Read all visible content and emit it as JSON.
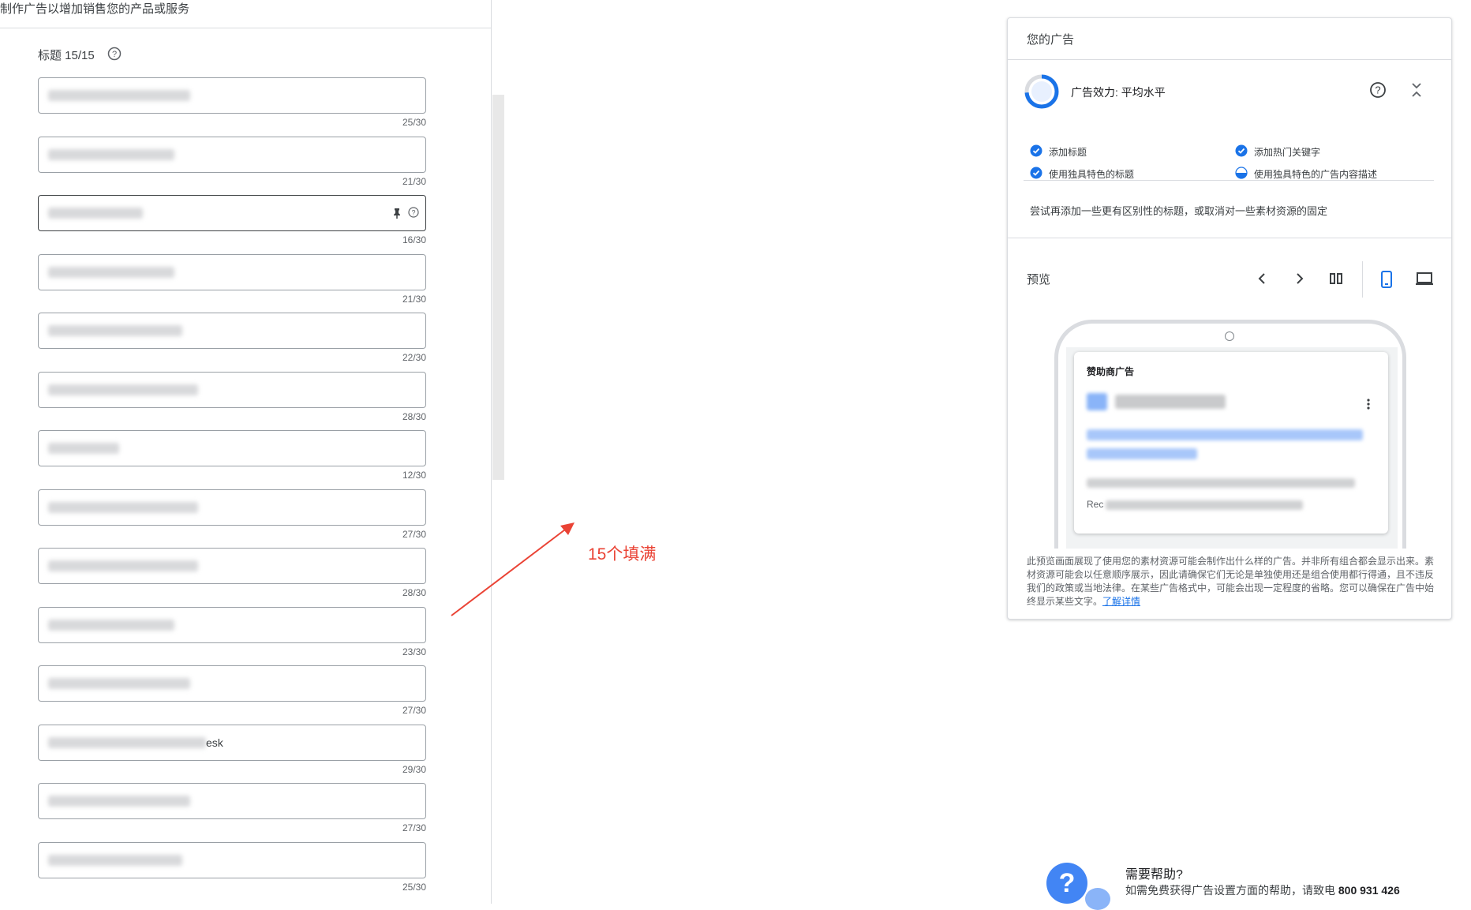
{
  "page": {
    "subtitle": "制作广告以增加销售您的产品或服务"
  },
  "headlines": {
    "label": "标题 15/15",
    "fields": [
      {
        "visible_text": "",
        "count": "25/30"
      },
      {
        "visible_text": "",
        "count": "21/30"
      },
      {
        "visible_text": "",
        "count": "16/30"
      },
      {
        "visible_text": "",
        "count": "21/30"
      },
      {
        "visible_text": "",
        "count": "22/30"
      },
      {
        "visible_text": "",
        "count": "28/30"
      },
      {
        "visible_text": "",
        "count": "12/30"
      },
      {
        "visible_text": "",
        "count": "27/30"
      },
      {
        "visible_text": "",
        "count": "28/30"
      },
      {
        "visible_text": "",
        "count": "23/30"
      },
      {
        "visible_text": "",
        "count": "27/30"
      },
      {
        "visible_text": "esk",
        "count": "29/30"
      },
      {
        "visible_text": "",
        "count": "27/30"
      },
      {
        "visible_text": "",
        "count": "25/30"
      }
    ]
  },
  "annotation": {
    "text": "15个填满",
    "color": "#ea4335"
  },
  "ad_card": {
    "title": "您的广告",
    "strength": "广告效力: 平均水平",
    "checklist": [
      {
        "label": "添加标题",
        "status": "done"
      },
      {
        "label": "添加热门关键字",
        "status": "done"
      },
      {
        "label": "使用独具特色的标题",
        "status": "done"
      },
      {
        "label": "使用独具特色的广告内容描述",
        "status": "partial"
      }
    ],
    "suggestion": "尝试再添加一些更有区别性的标题，或取消对一些素材资源的固定",
    "preview": {
      "label": "预览",
      "sponsored_label": "赞助商广告",
      "partial_text": "Rec"
    },
    "disclaimer": "此预览画面展现了使用您的素材资源可能会制作出什么样的广告。并非所有组合都会显示出来。素材资源可能会以任意顺序展示，因此请确保它们无论是单独使用还是组合使用都行得通，且不违反我们的政策或当地法律。在某些广告格式中，可能会出现一定程度的省略。您可以确保在广告中始终显示某些文字。",
    "learn_more": "了解详情"
  },
  "help": {
    "title": "需要帮助?",
    "line": "如需免费获得广告设置方面的帮助，请致电",
    "phone": "800 931 426"
  },
  "colors": {
    "accent": "#1a73e8",
    "border": "#dadce0",
    "annotation": "#ea4335"
  }
}
